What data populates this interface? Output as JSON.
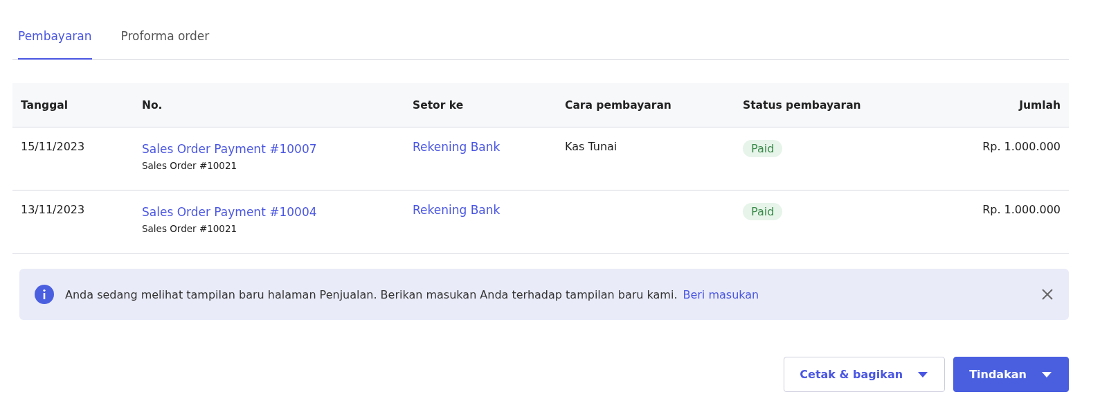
{
  "tabs": [
    {
      "label": "Pembayaran",
      "selected": true
    },
    {
      "label": "Proforma order",
      "selected": false
    }
  ],
  "table": {
    "columns": [
      "Tanggal",
      "No.",
      "Setor ke",
      "Cara pembayaran",
      "Status pembayaran",
      "Jumlah"
    ],
    "rows": [
      {
        "date": "15/11/2023",
        "number": "Sales Order Payment #10007",
        "reference": "Sales Order #10021",
        "deposit_to": "Rekening Bank",
        "method": "Kas Tunai",
        "status": {
          "label": "Paid",
          "kind": "paid"
        },
        "amount": "Rp. 1.000.000"
      },
      {
        "date": "13/11/2023",
        "number": "Sales Order Payment #10004",
        "reference": "Sales Order #10021",
        "deposit_to": "Rekening Bank",
        "status": {
          "label": "Paid",
          "kind": "paid"
        },
        "amount": "Rp. 1.000.000"
      }
    ]
  },
  "banner": {
    "message": "Anda sedang melihat tampilan baru halaman Penjualan. Berikan masukan Anda terhadap tampilan baru kami.",
    "link": "Beri masukan"
  },
  "buttons": [
    {
      "label": "Cetak & bagikan",
      "kind": "secondary"
    },
    {
      "label": "Tindakan",
      "kind": "primary"
    }
  ]
}
